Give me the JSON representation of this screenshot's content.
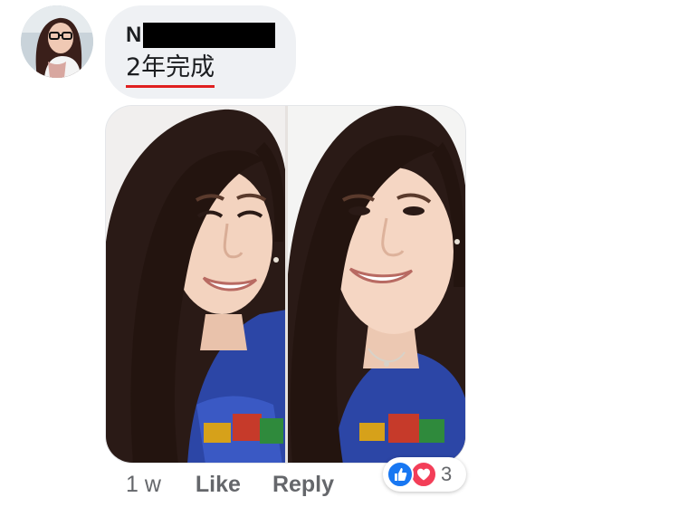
{
  "comment": {
    "author_initial": "N",
    "text": "2年完成",
    "timestamp": "1 w",
    "actions": {
      "like_label": "Like",
      "reply_label": "Reply"
    },
    "reactions": {
      "types": [
        "like-icon",
        "love-icon"
      ],
      "count": "3"
    }
  },
  "colors": {
    "bubble_bg": "#eff1f4",
    "underline": "#e02020",
    "like_blue": "#1877f2",
    "love_red": "#f33e58",
    "meta_gray": "#65676b"
  }
}
